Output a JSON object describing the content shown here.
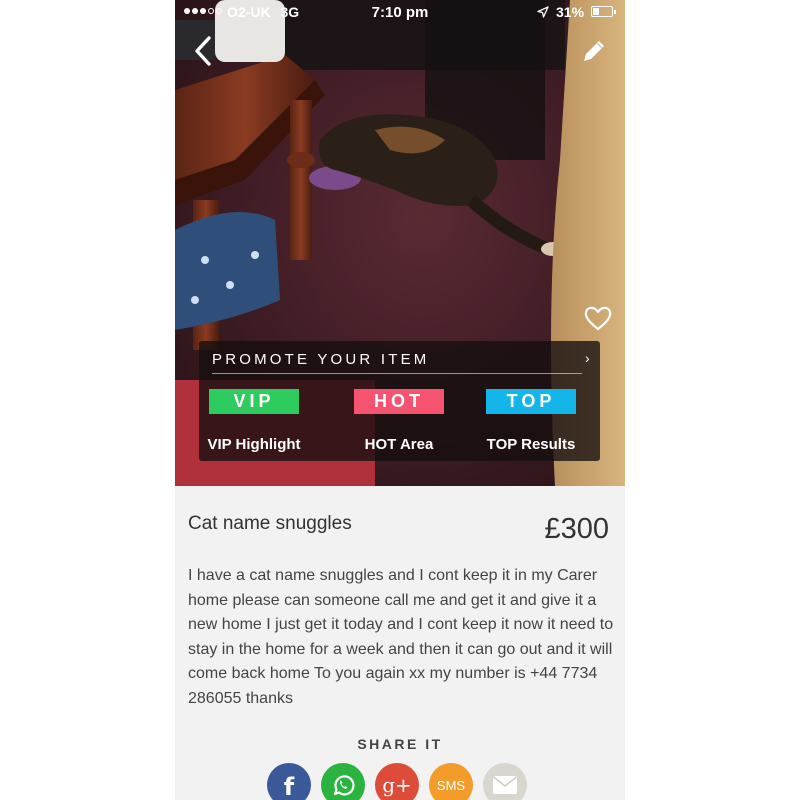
{
  "status_bar": {
    "carrier": "O2-UK",
    "network": "3G",
    "time": "7:10 pm",
    "battery_percent": "31%",
    "battery_level": 0.31,
    "signal_bars_filled": 3,
    "signal_bars_total": 5
  },
  "promote": {
    "title": "PROMOTE YOUR ITEM",
    "options": [
      {
        "badge": "VIP",
        "label": "VIP Highlight",
        "color": "#2ecc5e"
      },
      {
        "badge": "HOT",
        "label": "HOT Area",
        "color": "#f5536f"
      },
      {
        "badge": "TOP",
        "label": "TOP Results",
        "color": "#14b6ea"
      }
    ]
  },
  "listing": {
    "title": "Cat name snuggles",
    "price": "£300",
    "description": "I have a cat name snuggles and I cont keep it in my Carer home please can someone call me and get it and give it a new home I just get it today and I cont keep it now it need to stay in the home for a week and then it can go out and it will come back home To you again xx my number is +44 7734 286055 thanks"
  },
  "share": {
    "title": "SHARE IT",
    "buttons": [
      {
        "name": "facebook",
        "glyph": "f",
        "color": "#3b5998"
      },
      {
        "name": "whatsapp",
        "glyph": "",
        "color": "#2ab33f"
      },
      {
        "name": "google-plus",
        "glyph": "g+",
        "color": "#dd4b39"
      },
      {
        "name": "sms",
        "glyph": "SMS",
        "color": "#f39c2a"
      },
      {
        "name": "email",
        "glyph": "",
        "color": "#d9d5cf"
      }
    ]
  },
  "icons": {
    "back": "chevron-left-icon",
    "edit": "pencil-icon",
    "favorite": "heart-outline-icon"
  }
}
